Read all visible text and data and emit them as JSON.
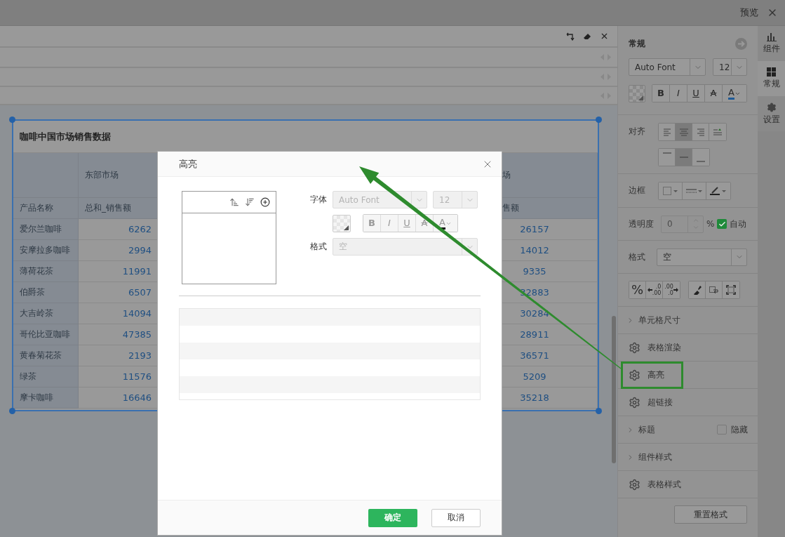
{
  "topbar": {
    "title": "预览"
  },
  "table": {
    "title": "咖啡中国市场销售数据",
    "group_headers": [
      "东部市场",
      "场"
    ],
    "columns": [
      "产品名称",
      "总和_销售额",
      "售额"
    ],
    "rows": [
      {
        "name": "爱尔兰咖啡",
        "values": [
          "6262",
          "26157"
        ]
      },
      {
        "name": "安摩拉多咖啡",
        "values": [
          "2994",
          "14012"
        ]
      },
      {
        "name": "薄荷花茶",
        "values": [
          "11991",
          "9335"
        ]
      },
      {
        "name": "伯爵茶",
        "values": [
          "6507",
          "32883"
        ]
      },
      {
        "name": "大吉岭茶",
        "values": [
          "14094",
          "30284"
        ]
      },
      {
        "name": "哥伦比亚咖啡",
        "values": [
          "47385",
          "28911"
        ]
      },
      {
        "name": "黄春菊花茶",
        "values": [
          "2193",
          "36571"
        ]
      },
      {
        "name": "绿茶",
        "values": [
          "11576",
          "5209"
        ]
      },
      {
        "name": "摩卡咖啡",
        "values": [
          "16646",
          "35218"
        ]
      }
    ]
  },
  "panel": {
    "title": "常规",
    "font": "Auto Font",
    "size": "12",
    "styles": [
      {
        "kind": "bold",
        "glyph": "B"
      },
      {
        "kind": "italic",
        "glyph": "I"
      },
      {
        "kind": "underline",
        "glyph": "U"
      },
      {
        "kind": "strike",
        "glyph": "A"
      },
      {
        "kind": "color",
        "glyph": "A"
      }
    ],
    "align_label": "对齐",
    "h_align": [
      {
        "kind": "left",
        "selected": false
      },
      {
        "kind": "center",
        "selected": true
      },
      {
        "kind": "right",
        "selected": false
      },
      {
        "kind": "order",
        "selected": false
      }
    ],
    "v_align": [
      {
        "kind": "top",
        "selected": false
      },
      {
        "kind": "middle",
        "selected": true
      },
      {
        "kind": "bottom",
        "selected": false
      }
    ],
    "border_label": "边框",
    "opacity_label": "透明度",
    "opacity": "0",
    "percent": "%",
    "auto": {
      "label": "自动",
      "checked": true
    },
    "format_label": "格式",
    "format": "空",
    "number_buttons": [
      {
        "kind": "percent",
        "glyph": "%"
      },
      {
        "kind": "increase",
        "top": ".0",
        "bottom": ".00"
      },
      {
        "kind": "decrease",
        "top": ".00",
        "bottom": ".0"
      }
    ],
    "items": [
      {
        "kind": "expander",
        "label": "单元格尺寸"
      },
      {
        "kind": "setting",
        "label": "表格渲染"
      },
      {
        "kind": "setting",
        "label": "高亮",
        "annotated": true
      },
      {
        "kind": "setting",
        "label": "超链接"
      },
      {
        "kind": "expander",
        "label": "标题",
        "checkbox": {
          "label": "隐藏",
          "checked": false
        }
      },
      {
        "kind": "expander",
        "label": "组件样式"
      },
      {
        "kind": "setting",
        "label": "表格样式"
      }
    ],
    "reset": "重置格式"
  },
  "side_tabs": [
    {
      "kind": "chart",
      "label": "组件",
      "selected": false
    },
    {
      "kind": "grid",
      "label": "常规",
      "selected": true
    },
    {
      "kind": "gear",
      "label": "设置",
      "selected": false
    }
  ],
  "dialog": {
    "title": "高亮",
    "font_label": "字体",
    "font": "Auto Font",
    "size": "12",
    "disabled": true,
    "styles": [
      {
        "kind": "bold",
        "glyph": "B"
      },
      {
        "kind": "italic",
        "glyph": "I"
      },
      {
        "kind": "underline",
        "glyph": "U"
      },
      {
        "kind": "strike",
        "glyph": "A"
      },
      {
        "kind": "color",
        "glyph": "A"
      }
    ],
    "format_label": "格式",
    "format": "空",
    "confirm": "确定",
    "cancel": "取消"
  }
}
